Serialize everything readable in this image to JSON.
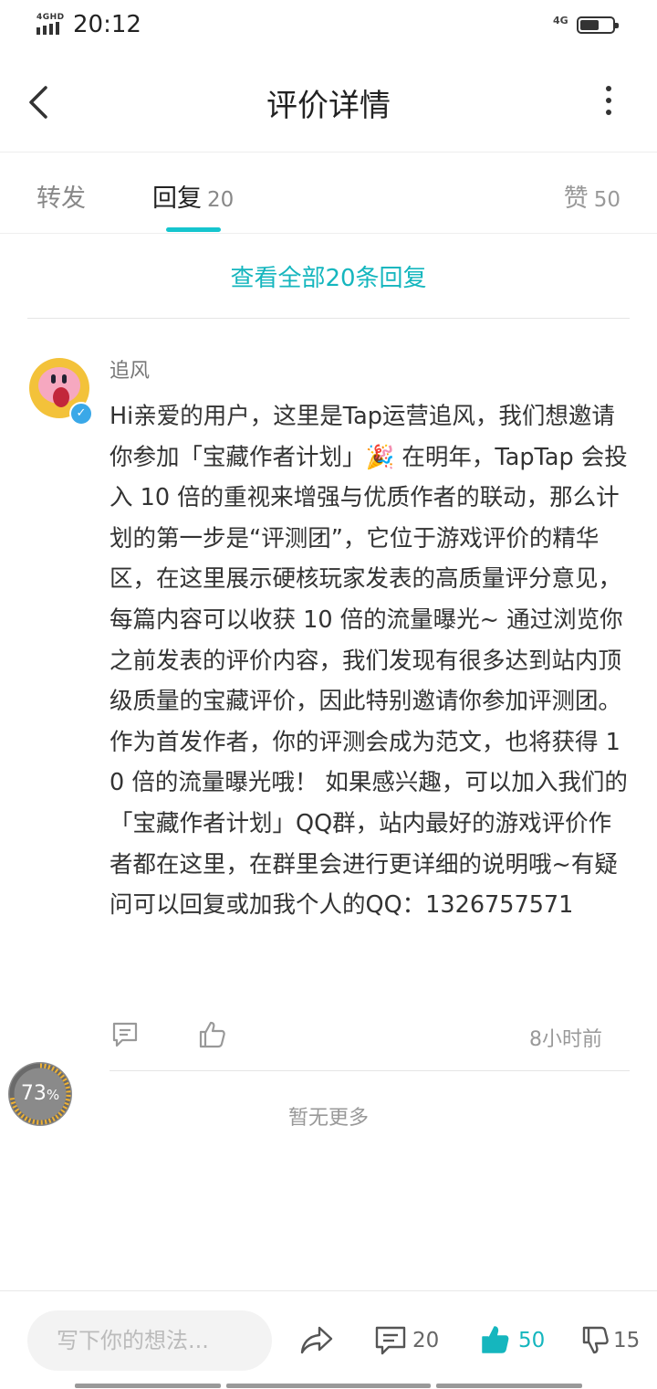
{
  "status": {
    "network": "4GHD",
    "time": "20:12",
    "net_right": "4G",
    "battery_level": 0.6
  },
  "header": {
    "title": "评价详情"
  },
  "tabs": {
    "forward": "转发",
    "reply": "回复",
    "reply_count": "20",
    "like": "赞",
    "like_count": "50"
  },
  "view_all": "查看全部20条回复",
  "comment": {
    "user": "追风",
    "text": "Hi亲爱的用户，这里是Tap运营追风，我们想邀请你参加「宝藏作者计划」🎉 在明年，TapTap 会投入 10 倍的重视来增强与优质作者的联动，那么计划的第一步是“评测团”，它位于游戏评价的精华区，在这里展示硬核玩家发表的高质量评分意见，每篇内容可以收获 10 倍的流量曝光~ 通过浏览你之前发表的评价内容，我们发现有很多达到站内顶级质量的宝藏评价，因此特别邀请你参加评测团。作为首发作者，你的评测会成为范文，也将获得 10 倍的流量曝光哦！ 如果感兴趣，可以加入我们的「宝藏作者计划」QQ群，站内最好的游戏评价作者都在这里，在群里会进行更详细的说明哦~有疑问可以回复或加我个人的QQ：1326757571",
    "time": "8小时前"
  },
  "no_more": "暂无更多",
  "progress": {
    "value": "73",
    "unit": "%"
  },
  "bottom": {
    "input_placeholder": "写下你的想法...",
    "comment_count": "20",
    "like_count": "50",
    "dislike_count": "15"
  },
  "colors": {
    "accent": "#15b6be",
    "indicator": "#15c5ce"
  }
}
